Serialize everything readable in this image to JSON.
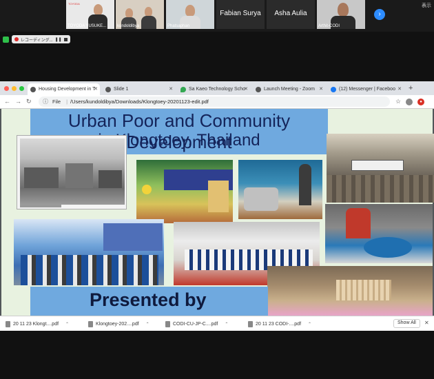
{
  "zoom": {
    "participants": [
      {
        "name": "TOYODA YUSUKE...",
        "has_video": true
      },
      {
        "name": "kundoldibya",
        "has_video": true
      },
      {
        "name": "Phatsaphan",
        "has_video": true
      },
      {
        "name": "Fabian Surya",
        "has_video": false
      },
      {
        "name": "Asha Aulia",
        "has_video": false
      },
      {
        "name": "Arthit-CODI",
        "has_video": true
      }
    ],
    "display_label": "表示",
    "next_icon": "chevron-right-icon",
    "recording_label": "レコーディング..."
  },
  "browser": {
    "tabs": [
      {
        "title": "Housing Development in T",
        "active": true,
        "icon": "globe-icon"
      },
      {
        "title": "Slide 1",
        "active": false,
        "icon": "globe-icon"
      },
      {
        "title": "Sa Kaeo Technology Scho",
        "active": false,
        "icon": "map-pin-icon"
      },
      {
        "title": "Launch Meeting - Zoom",
        "active": false,
        "icon": "globe-icon"
      },
      {
        "title": "(12) Messenger | Faceboo",
        "active": false,
        "icon": "facebook-icon"
      }
    ],
    "address": {
      "scheme_label": "File",
      "url": "/Users/kundoldibya/Downloads/Klongtoey-20201123-edit.pdf"
    }
  },
  "slide": {
    "title_line1": "Urban Poor and Community Development",
    "title_line2": "in Klongtoey, Thailand",
    "presented_by": "Presented by"
  },
  "downloads": {
    "items": [
      {
        "name": "20 11 23 Klongt....pdf"
      },
      {
        "name": "Klongtoey-202....pdf"
      },
      {
        "name": "CODI-CU-JP-C....pdf"
      },
      {
        "name": "20 11 23 CODI-....pdf"
      }
    ],
    "show_all_label": "Show All"
  },
  "colors": {
    "title_band": "#6fa9df",
    "slide_bg": "#e8f2e0",
    "zoom_accent": "#2d8cff"
  }
}
